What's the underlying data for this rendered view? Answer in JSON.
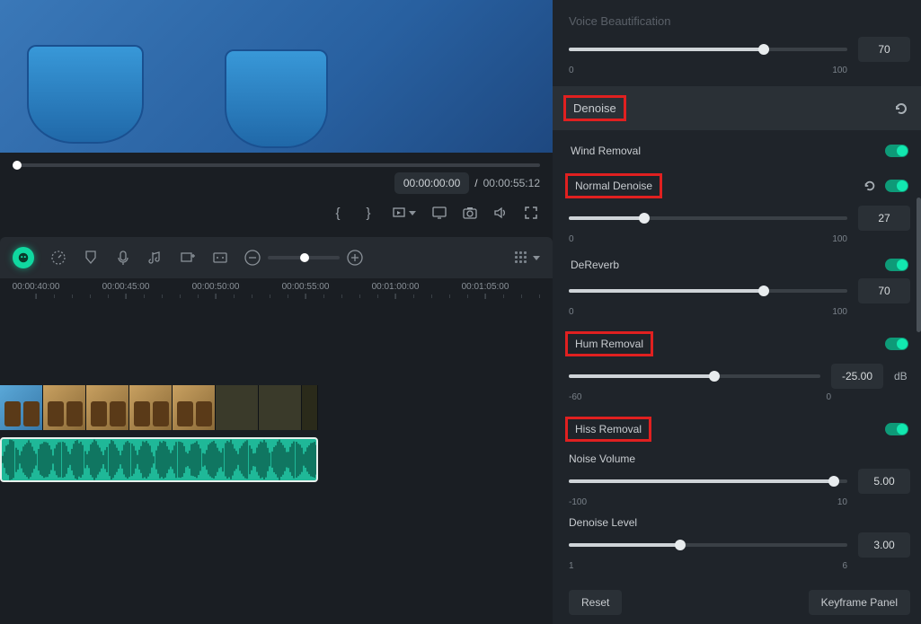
{
  "preview": {
    "timecode_current": "00:00:00:00",
    "timecode_total": "00:00:55:12"
  },
  "timeline": {
    "zoom_percent": 45,
    "ticks": [
      "00:00:40:00",
      "00:00:45:00",
      "00:00:50:00",
      "00:00:55:00",
      "00:01:00:00",
      "00:01:05:00"
    ]
  },
  "panel": {
    "voice_beautification": {
      "label": "Voice Beautification",
      "value": "70",
      "min": "0",
      "max": "100",
      "percent": 70
    },
    "denoise_header": "Denoise",
    "wind_removal": {
      "label": "Wind Removal",
      "on": true
    },
    "normal_denoise": {
      "label": "Normal Denoise",
      "value": "27",
      "min": "0",
      "max": "100",
      "percent": 27,
      "on": true
    },
    "dereverb": {
      "label": "DeReverb",
      "value": "70",
      "min": "0",
      "max": "100",
      "percent": 70,
      "on": true
    },
    "hum_removal": {
      "label": "Hum Removal",
      "value": "-25.00",
      "unit": "dB",
      "min": "-60",
      "max": "0",
      "percent": 58,
      "on": true
    },
    "hiss_removal": {
      "label": "Hiss Removal",
      "on": true
    },
    "noise_volume": {
      "label": "Noise Volume",
      "value": "5.00",
      "min": "-100",
      "max": "10",
      "percent": 95
    },
    "denoise_level": {
      "label": "Denoise Level",
      "value": "3.00",
      "min": "1",
      "max": "6",
      "percent": 40
    },
    "reset": "Reset",
    "keyframe_panel": "Keyframe Panel"
  }
}
